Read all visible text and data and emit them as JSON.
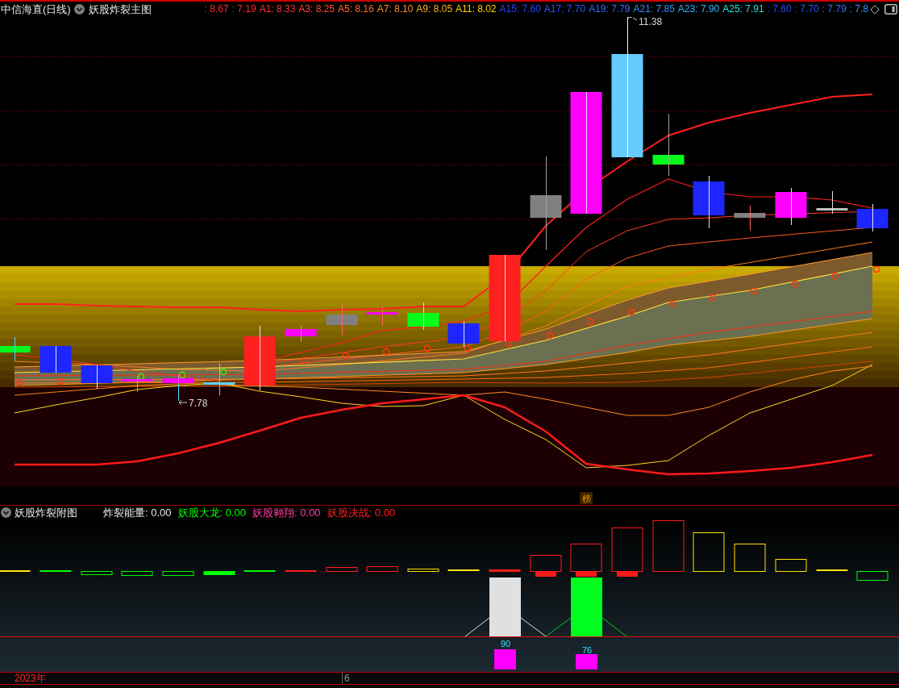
{
  "header": {
    "title": "中信海直(日线)",
    "indicator": "妖股炸裂主图",
    "values": [
      {
        "text": ": 8.67",
        "color": "#ff2a2a"
      },
      {
        "text": ": 7.19",
        "color": "#ff2a2a"
      },
      {
        "text": "A1: 8.33",
        "color": "#ff3030"
      },
      {
        "text": "A3: 8.25",
        "color": "#ff4a30"
      },
      {
        "text": "A5: 8.16",
        "color": "#ff6a28"
      },
      {
        "text": "A7: 8.10",
        "color": "#ff8c20"
      },
      {
        "text": "A9: 8.05",
        "color": "#ffae10"
      },
      {
        "text": "A11: 8.02",
        "color": "#ffd400"
      },
      {
        "text": "A15: 7.60",
        "color": "#2448ff"
      },
      {
        "text": "A17: 7.70",
        "color": "#2a58ff"
      },
      {
        "text": "A19: 7.79",
        "color": "#3070ff"
      },
      {
        "text": "A21: 7.85",
        "color": "#3490ff"
      },
      {
        "text": "A23: 7.90",
        "color": "#30b4ff"
      },
      {
        "text": "A25: 7.91",
        "color": "#20e4e4"
      },
      {
        "text": ": 7.60",
        "color": "#2448ff"
      },
      {
        "text": ": 7.70",
        "color": "#2a58ff"
      },
      {
        "text": ": 7.79",
        "color": "#3070ff"
      },
      {
        "text": ": 7.8",
        "color": "#3490ff"
      }
    ]
  },
  "main_chart": {
    "high_label": "11.38",
    "low_label": "7.78",
    "badge": "榜"
  },
  "sub_header": {
    "indicator": "妖股炸裂附图",
    "values": [
      {
        "text": "炸裂能量: 0.00",
        "color": "#e8e8e8"
      },
      {
        "text": "妖股大龙: 0.00",
        "color": "#00ff00"
      },
      {
        "text": "妖股翱翔: 0.00",
        "color": "#ff40a0"
      },
      {
        "text": "妖股决战: 0.00",
        "color": "#ff2020"
      }
    ]
  },
  "sub_chart": {
    "block_labels": [
      "90",
      "76"
    ]
  },
  "time_axis": {
    "year": "2023年",
    "month": "6"
  }
}
